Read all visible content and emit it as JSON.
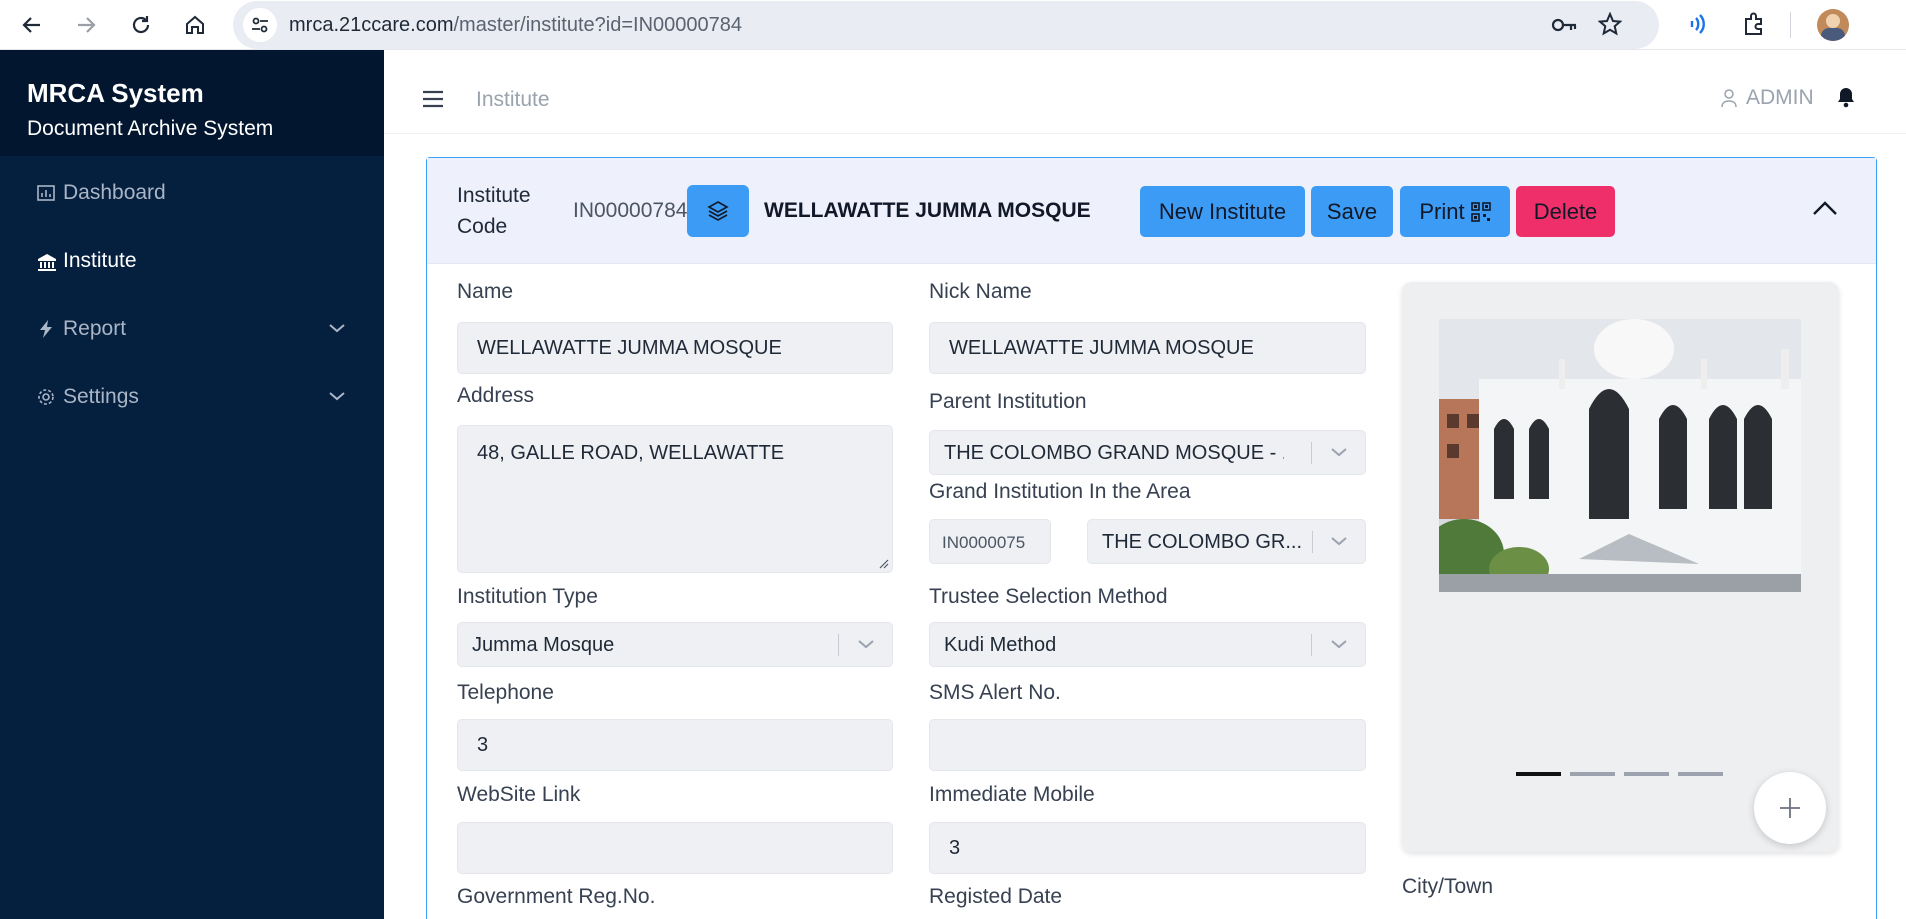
{
  "browser": {
    "url_host": "mrca.21ccare.com",
    "url_path": "/master/institute?id=IN00000784"
  },
  "sidebar": {
    "title": "MRCA System",
    "subtitle": "Document Archive System",
    "items": [
      {
        "label": "Dashboard",
        "icon": "dashboard-icon"
      },
      {
        "label": "Institute",
        "icon": "institution-icon"
      },
      {
        "label": "Report",
        "icon": "bolt-icon"
      },
      {
        "label": "Settings",
        "icon": "gear-icon"
      }
    ]
  },
  "topbar": {
    "page": "Institute",
    "user": "ADMIN"
  },
  "header": {
    "code_label": "Institute Code",
    "code_value": "IN00000784",
    "institute_name": "WELLAWATTE JUMMA MOSQUE",
    "buttons": {
      "new": "New Institute",
      "save": "Save",
      "print": "Print",
      "delete": "Delete"
    }
  },
  "form": {
    "name_label": "Name",
    "name_value": "WELLAWATTE JUMMA MOSQUE",
    "nickname_label": "Nick Name",
    "nickname_value": "WELLAWATTE JUMMA MOSQUE",
    "address_label": "Address",
    "address_value": "48, GALLE ROAD,  WELLAWATTE",
    "parent_label": "Parent Institution",
    "parent_value": "THE COLOMBO GRAND MOSQUE - ...",
    "grand_label": "Grand Institution In the Area",
    "grand_code": "IN0000075",
    "grand_value": "THE COLOMBO GR...",
    "type_label": "Institution Type",
    "type_value": "Jumma Mosque",
    "trustee_label": "Trustee Selection Method",
    "trustee_value": "Kudi Method",
    "telephone_label": "Telephone",
    "telephone_value": "3",
    "sms_label": "SMS Alert No.",
    "sms_value": "",
    "website_label": "WebSite Link",
    "website_value": "",
    "mobile_label": "Immediate Mobile",
    "mobile_value": "3",
    "govreg_label": "Government Reg.No.",
    "registed_label": "Registed Date",
    "city_label": "City/Town"
  },
  "carousel": {
    "slide_count": 4,
    "active_index": 0
  },
  "colors": {
    "sidebar_bg": "#051f3e",
    "accent_blue": "#3b9bf5",
    "delete_red": "#ef2f6a"
  }
}
